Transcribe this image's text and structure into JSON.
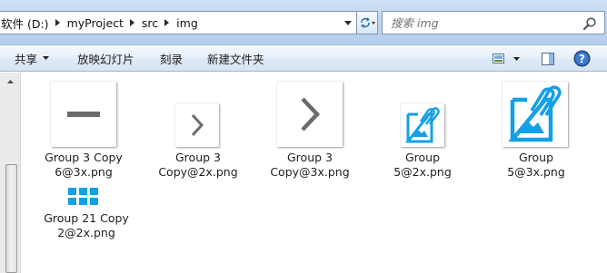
{
  "address_bar": {
    "breadcrumb": [
      "软件 (D:)",
      "myProject",
      "src",
      "img"
    ]
  },
  "search": {
    "placeholder": "搜索 img"
  },
  "command_bar": {
    "share_label": "共享",
    "slideshow_label": "放映幻灯片",
    "burn_label": "刻录",
    "new_folder_label": "新建文件夹"
  },
  "files": [
    {
      "line1": "Group 3 Copy",
      "line2": "6@3x.png",
      "icon": "minus-icon"
    },
    {
      "line1": "Group 3",
      "line2": "Copy@2x.png",
      "icon": "chevron-right-icon"
    },
    {
      "line1": "Group 3",
      "line2": "Copy@3x.png",
      "icon": "chevron-right-icon"
    },
    {
      "line1": "Group",
      "line2": "5@2x.png",
      "icon": "image-clip-icon"
    },
    {
      "line1": "Group",
      "line2": "5@3x.png",
      "icon": "image-clip-icon"
    },
    {
      "line1": "Group 21 Copy",
      "line2": "2@2x.png",
      "icon": "grid-icon"
    }
  ],
  "colors": {
    "accent_blue": "#14a0e6",
    "icon_gray": "#6b6b6b"
  }
}
